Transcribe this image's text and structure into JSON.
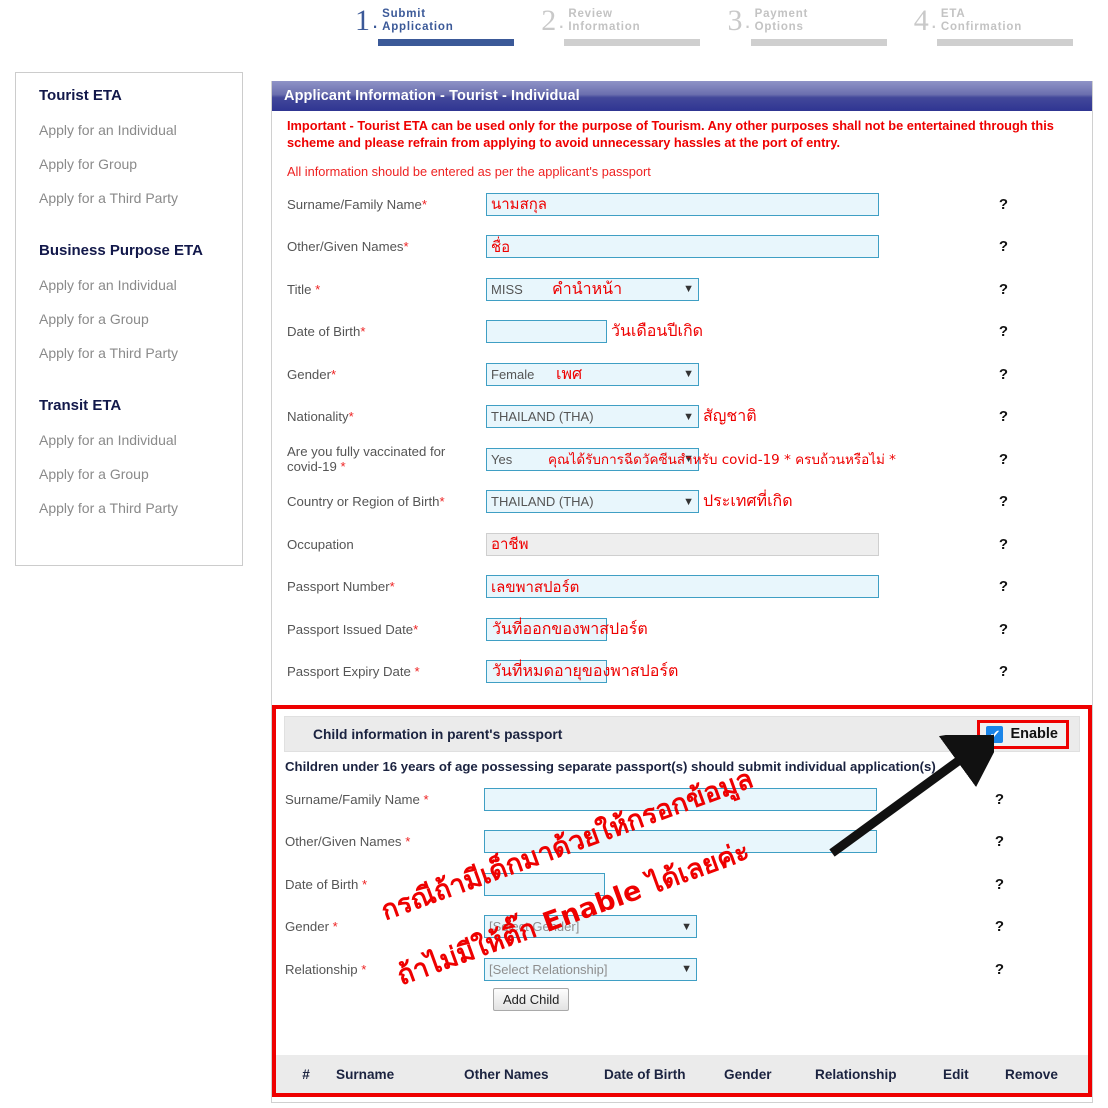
{
  "steps": [
    {
      "num": "1",
      "line1": "Submit",
      "line2": "Application",
      "active": true
    },
    {
      "num": "2",
      "line1": "Review",
      "line2": "Information",
      "active": false
    },
    {
      "num": "3",
      "line1": "Payment",
      "line2": "Options",
      "active": false
    },
    {
      "num": "4",
      "line1": "ETA",
      "line2": "Confirmation",
      "active": false
    }
  ],
  "sidebar": {
    "groups": [
      {
        "title": "Tourist ETA",
        "items": [
          "Apply for an Individual",
          "Apply for Group",
          "Apply for a Third Party"
        ]
      },
      {
        "title": "Business Purpose ETA",
        "items": [
          "Apply for an Individual",
          "Apply for a Group",
          "Apply for a Third Party"
        ]
      },
      {
        "title": "Transit ETA",
        "items": [
          "Apply for an Individual",
          "Apply for a Group",
          "Apply for a Third Party"
        ]
      }
    ]
  },
  "form": {
    "header": "Applicant Information - Tourist - Individual",
    "notice": "Important - Tourist ETA can be used only for the purpose of Tourism. Any other purposes shall not be entertained through this scheme and please refrain from applying to avoid unnecessary hassles at the port of entry.",
    "subnotice": "All information should be entered as per the applicant's passport",
    "help_marker": "?",
    "fields": [
      {
        "label": "Surname/Family Name",
        "req": "*",
        "type": "text",
        "value": "",
        "thai_inside": "นามสกุล",
        "thai_after": ""
      },
      {
        "label": "Other/Given Names",
        "req": "*",
        "type": "text",
        "value": "",
        "thai_inside": "ชื่อ",
        "thai_after": ""
      },
      {
        "label": "Title ",
        "req": "*",
        "type": "select",
        "value": "MISS",
        "thai_inside": "คำนำหน้า",
        "thai_after": ""
      },
      {
        "label": "Date of Birth",
        "req": "*",
        "type": "date",
        "value": "",
        "thai_inside": "",
        "thai_after": "วันเดือนปีเกิด"
      },
      {
        "label": "Gender",
        "req": "*",
        "type": "select",
        "value": "Female",
        "thai_inside": "เพศ",
        "thai_after": ""
      },
      {
        "label": "Nationality",
        "req": "*",
        "type": "select",
        "value": "THAILAND (THA)",
        "thai_inside": "",
        "thai_after": "สัญชาติ"
      },
      {
        "label": "Are you fully vaccinated for covid-19 ",
        "req": "*",
        "type": "select",
        "value": "Yes",
        "thai_inside": "คุณได้รับการฉีดวัคซีนสำหรับ covid-19 * ครบถ้วนหรือไม่ *",
        "thai_after": ""
      },
      {
        "label": "Country or Region of Birth",
        "req": "*",
        "type": "select",
        "value": "THAILAND (THA)",
        "thai_inside": "",
        "thai_after": "ประเทศที่เกิด"
      },
      {
        "label": "Occupation",
        "req": "",
        "type": "text-disabled",
        "value": "",
        "thai_inside": "อาชีพ",
        "thai_after": ""
      },
      {
        "label": "Passport Number",
        "req": "*",
        "type": "text",
        "value": "",
        "thai_inside": "เลขพาสปอร์ต",
        "thai_after": ""
      },
      {
        "label": "Passport Issued Date",
        "req": "*",
        "type": "date",
        "value": "",
        "thai_inside": "",
        "thai_after": "วันที่ออกของพาสปอร์ต"
      },
      {
        "label": "Passport Expiry Date ",
        "req": "*",
        "type": "date",
        "value": "",
        "thai_inside": "",
        "thai_after": "วันที่หมดอายุของพาสปอร์ต"
      }
    ]
  },
  "child_section": {
    "title": "Child information in parent's passport",
    "enable_label": "Enable",
    "enable_checked": true,
    "check_glyph": "✔",
    "subtitle": "Children under 16 years of age possessing separate passport(s) should submit individual application(s)",
    "help_marker": "?",
    "fields": [
      {
        "label": "Surname/Family Name ",
        "req": "*",
        "type": "text",
        "value": ""
      },
      {
        "label": "Other/Given Names ",
        "req": "*",
        "type": "text",
        "value": ""
      },
      {
        "label": "Date of Birth ",
        "req": "*",
        "type": "date",
        "value": ""
      },
      {
        "label": "Gender ",
        "req": "*",
        "type": "select",
        "value": "[Select Gender]"
      },
      {
        "label": "Relationship ",
        "req": "*",
        "type": "select",
        "value": "[Select Relationship]"
      }
    ],
    "add_button": "Add Child",
    "table_headers": [
      "#",
      "Surname",
      "Other Names",
      "Date of Birth",
      "Gender",
      "Relationship",
      "Edit",
      "Remove"
    ]
  },
  "annotations": {
    "line1": "กรณีถ้ามีเด็กมาด้วยให้กรอกข้อมูล",
    "line2": "ถ้าไม่มีให้ติ๊ก Enable ได้เลยค่ะ"
  },
  "colors": {
    "accent_blue": "#3b5998",
    "header_purple": "#43489a",
    "alert_red": "#ee0000",
    "field_blue_border": "#3f9fc4",
    "field_blue_bg": "#e8f6fc",
    "checkbox_blue": "#1a84e8"
  }
}
